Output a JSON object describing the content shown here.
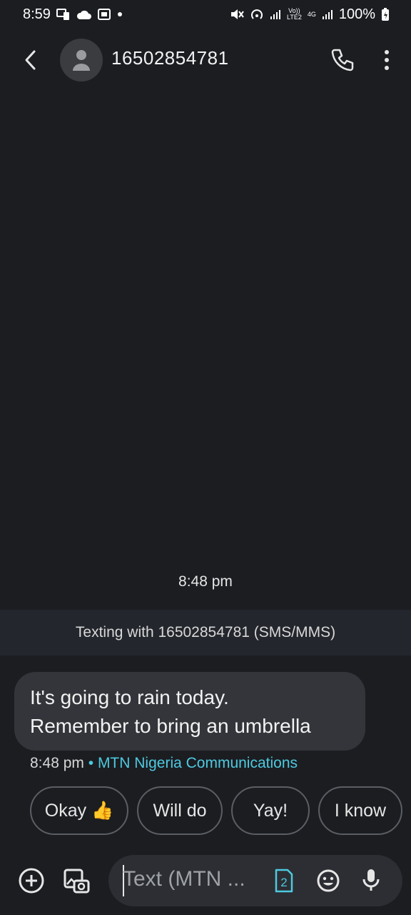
{
  "status_bar": {
    "time": "8:59",
    "battery": "100%",
    "lte_label": "LTE2",
    "volte_label": "Vo))",
    "net_label": "4G"
  },
  "header": {
    "title": "16502854781",
    "icons": [
      "back-arrow-icon",
      "contact-avatar-icon",
      "phone-call-icon",
      "more-vert-icon"
    ]
  },
  "conversation": {
    "date_divider": "8:48 pm",
    "texting_banner": "Texting with 16502854781 (SMS/MMS)",
    "message": {
      "line1": "It's going to rain today.",
      "line2": "Remember to bring an umbrella",
      "time": "8:48 pm",
      "separator": "•",
      "carrier": "MTN Nigeria Communications"
    }
  },
  "smart_replies": [
    "Okay 👍",
    "Will do",
    "Yay!",
    "I know"
  ],
  "composer": {
    "placeholder": "Text (MTN ...",
    "sim_number": "2",
    "icons": [
      "add-icon",
      "gallery-icon",
      "emoji-icon",
      "mic-icon"
    ]
  },
  "colors": {
    "background": "#1b1d21",
    "banner": "#23262c",
    "bubble": "#33353a",
    "accent": "#4ec9e0"
  }
}
